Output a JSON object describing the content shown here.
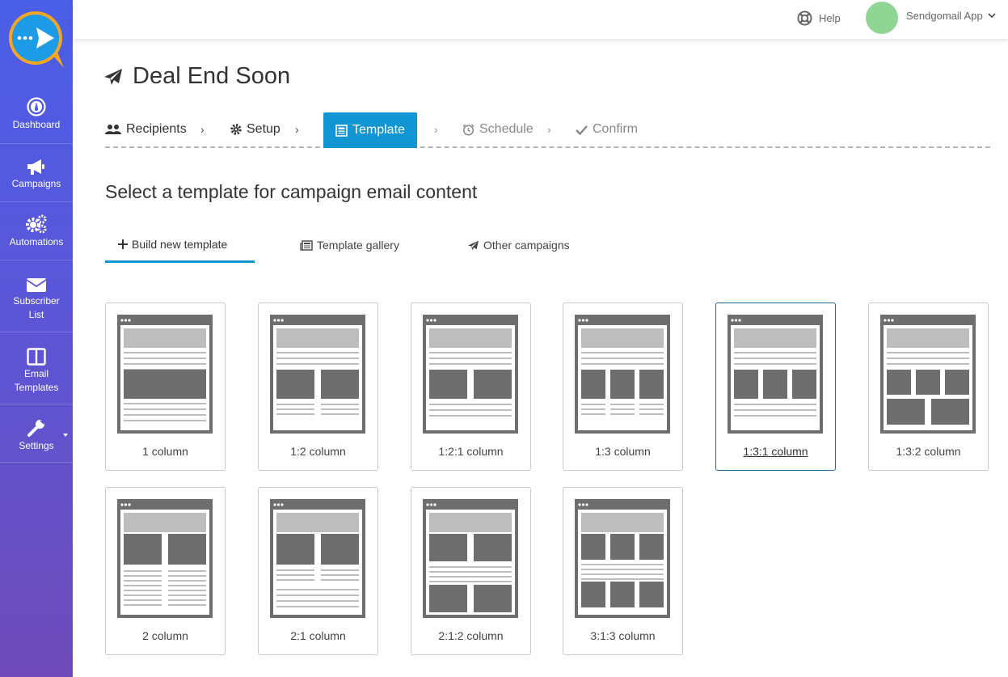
{
  "sidebar": {
    "items": [
      {
        "label": "Dashboard"
      },
      {
        "label": "Campaigns"
      },
      {
        "label": "Automations"
      },
      {
        "label": "Subscriber",
        "label2": "List"
      },
      {
        "label": "Email",
        "label2": "Templates"
      },
      {
        "label": "Settings"
      }
    ]
  },
  "topbar": {
    "help": "Help",
    "account": "Sendgomail App"
  },
  "page": {
    "title": "Deal End Soon",
    "subheading": "Select a template for campaign email content"
  },
  "steps": [
    {
      "label": "Recipients"
    },
    {
      "label": "Setup"
    },
    {
      "label": "Template"
    },
    {
      "label": "Schedule"
    },
    {
      "label": "Confirm"
    }
  ],
  "step_separator": "›",
  "tabs": [
    {
      "label": "Build new template"
    },
    {
      "label": "Template gallery"
    },
    {
      "label": "Other campaigns"
    }
  ],
  "templates": [
    {
      "label": "1 column"
    },
    {
      "label": "1:2 column"
    },
    {
      "label": "1:2:1 column"
    },
    {
      "label": "1:3 column"
    },
    {
      "label": "1:3:1 column"
    },
    {
      "label": "1:3:2 column"
    },
    {
      "label": "2 column"
    },
    {
      "label": "2:1 column"
    },
    {
      "label": "2:1:2 column"
    },
    {
      "label": "3:1:3 column"
    }
  ],
  "colors": {
    "accent": "#1296d3",
    "sidebar_top": "#4a5ee8",
    "sidebar_bottom": "#6e4bb8",
    "avatar": "#8fd694"
  }
}
